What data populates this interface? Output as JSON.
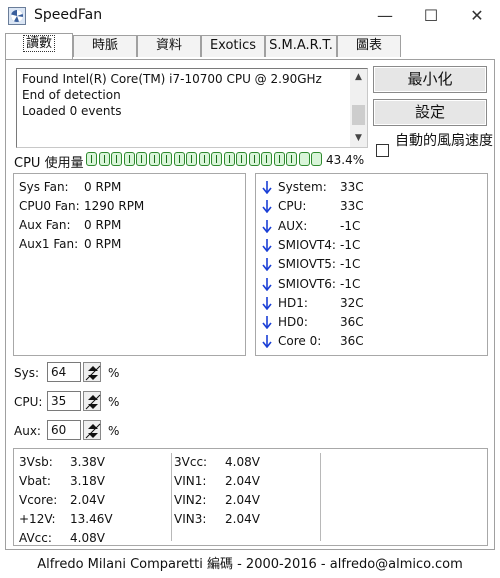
{
  "window": {
    "title": "SpeedFan",
    "minimize_glyph": "—",
    "maximize_glyph": "☐",
    "close_glyph": "✕"
  },
  "tabs": [
    {
      "label": "讀數",
      "active": true
    },
    {
      "label": "時脈",
      "active": false
    },
    {
      "label": "資料",
      "active": false
    },
    {
      "label": "Exotics",
      "active": false
    },
    {
      "label": "S.M.A.R.T.",
      "active": false
    },
    {
      "label": "圖表",
      "active": false
    }
  ],
  "log": {
    "lines": [
      "Found Intel(R) Core(TM) i7-10700 CPU @ 2.90GHz",
      "End of detection",
      "Loaded 0 events"
    ]
  },
  "buttons": {
    "minimize_label": "最小化",
    "settings_label": "設定"
  },
  "auto_fan": {
    "label": "自動的風扇速度",
    "checked": false
  },
  "cpu_usage": {
    "label": "CPU 使用量",
    "percent_text": "43.4%",
    "segments_total": 19,
    "segments_filled": 17
  },
  "fans": [
    {
      "name": "Sys Fan:",
      "value": "0 RPM"
    },
    {
      "name": "CPU0 Fan:",
      "value": "1290 RPM"
    },
    {
      "name": "Aux Fan:",
      "value": "0 RPM"
    },
    {
      "name": "Aux1 Fan:",
      "value": "0 RPM"
    }
  ],
  "temps": [
    {
      "name": "System:",
      "value": "33C"
    },
    {
      "name": "CPU:",
      "value": "33C"
    },
    {
      "name": "AUX:",
      "value": "-1C"
    },
    {
      "name": "SMIOVT4:",
      "value": "-1C"
    },
    {
      "name": "SMIOVT5:",
      "value": "-1C"
    },
    {
      "name": "SMIOVT6:",
      "value": "-1C"
    },
    {
      "name": "HD1:",
      "value": "32C"
    },
    {
      "name": "HD0:",
      "value": "36C"
    },
    {
      "name": "Core 0:",
      "value": "36C"
    }
  ],
  "speeds": [
    {
      "name": "Sys:",
      "value": "64",
      "unit": "%"
    },
    {
      "name": "CPU:",
      "value": "35",
      "unit": "%"
    },
    {
      "name": "Aux:",
      "value": "60",
      "unit": "%"
    }
  ],
  "voltages": {
    "col1": [
      {
        "name": "3Vsb:",
        "value": "3.38V"
      },
      {
        "name": "Vbat:",
        "value": "3.18V"
      },
      {
        "name": "Vcore:",
        "value": "2.04V"
      },
      {
        "name": "+12V:",
        "value": "13.46V"
      },
      {
        "name": "AVcc:",
        "value": "4.08V"
      }
    ],
    "col2": [
      {
        "name": "3Vcc:",
        "value": "4.08V"
      },
      {
        "name": "VIN1:",
        "value": "2.04V"
      },
      {
        "name": "VIN2:",
        "value": "2.04V"
      },
      {
        "name": "VIN3:",
        "value": "2.04V"
      }
    ]
  },
  "status": {
    "text": "Alfredo Milani Comparetti 編碼 - 2000-2016 - alfredo@almico.com"
  },
  "colors": {
    "temp_arrow": "#1a3fd6",
    "cpu_bar": "#2e8a2e"
  }
}
